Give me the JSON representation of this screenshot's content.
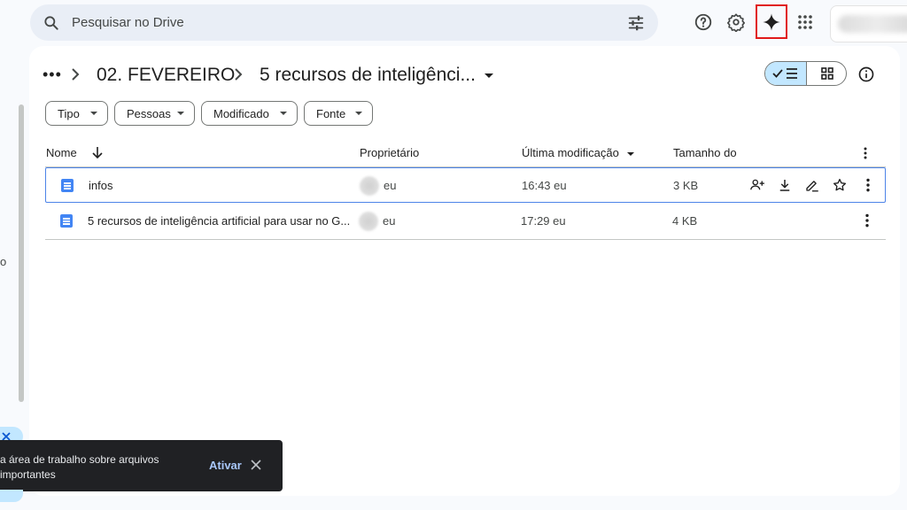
{
  "search": {
    "placeholder": "Pesquisar no Drive"
  },
  "breadcrumb": {
    "ellipsis": "•••",
    "parent": "02. FEVEREIRO",
    "current": "5 recursos de inteligênci..."
  },
  "filters": [
    "Tipo",
    "Pessoas",
    "Modificado",
    "Fonte"
  ],
  "columns": {
    "name": "Nome",
    "owner": "Proprietário",
    "modified": "Última modificação",
    "size": "Tamanho do"
  },
  "files": [
    {
      "name": "infos",
      "owner": "eu",
      "modified": "16:43 eu",
      "size": "3 KB"
    },
    {
      "name": "5 recursos de inteligência artificial para usar no G...",
      "owner": "eu",
      "modified": "17:29 eu",
      "size": "4 KB"
    }
  ],
  "toast": {
    "message_line1": "a área de trabalho sobre arquivos",
    "message_line2": "importantes",
    "action": "Ativar"
  },
  "colors": {
    "accent": "#0b57d0",
    "selected_border": "#4d84e8",
    "highlight_red": "#e11a1a",
    "doc_blue": "#4285f4"
  },
  "icons": [
    "search-icon",
    "filter-settings-icon",
    "help-icon",
    "settings-icon",
    "gemini-sparkle-icon",
    "apps-grid-icon",
    "info-icon",
    "list-view-icon",
    "grid-view-icon",
    "sort-arrow-icon",
    "more-vert-icon",
    "share-person-icon",
    "download-icon",
    "rename-pen-icon",
    "star-icon",
    "close-icon",
    "doc-icon"
  ]
}
